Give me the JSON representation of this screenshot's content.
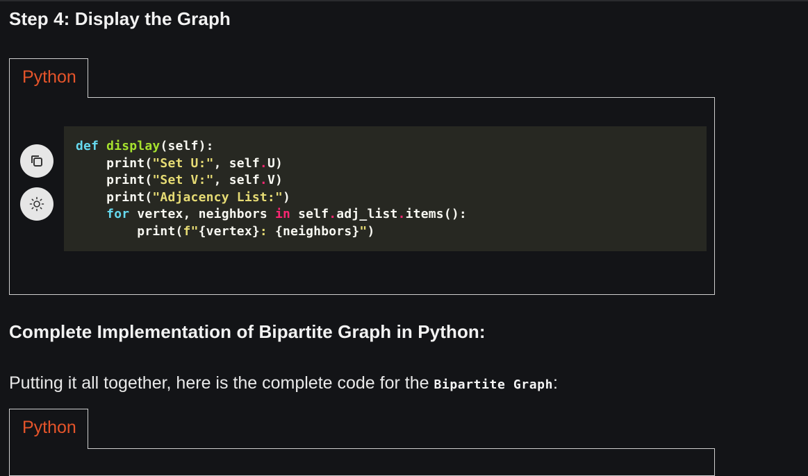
{
  "step_heading": "Step 4: Display the Graph",
  "tabs": {
    "first": "Python",
    "second": "Python"
  },
  "code_lines": [
    "def display(self):",
    "    print(\"Set U:\", self.U)",
    "    print(\"Set V:\", self.V)",
    "    print(\"Adjacency List:\")",
    "    for vertex, neighbors in self.adj_list.items():",
    "        print(f\"{vertex}: {neighbors}\")"
  ],
  "section_heading": "Complete Implementation of Bipartite Graph in Python:",
  "paragraph": {
    "text": "Putting it all together, here is the complete code for the ",
    "code": "Bipartite Graph",
    "suffix": ":"
  },
  "icons": {
    "copy": "copy-icon",
    "theme": "sun-icon"
  }
}
